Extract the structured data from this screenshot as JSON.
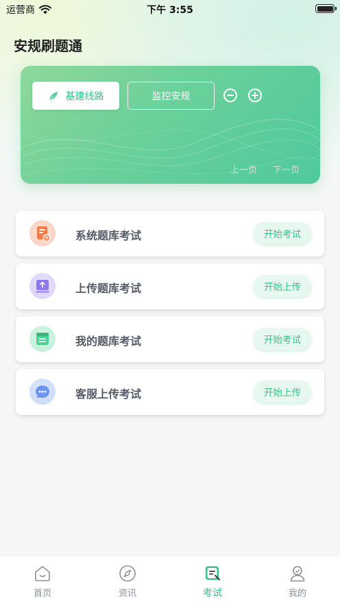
{
  "status_bar": {
    "carrier": "运营商",
    "time": "下午 3:55"
  },
  "page_title": "安规刷题通",
  "hero": {
    "routes": [
      {
        "label": "基建线路",
        "selected": true
      },
      {
        "label": "监控安规",
        "selected": false
      }
    ],
    "prev_page": "上一页",
    "next_page": "下一页"
  },
  "cards": [
    {
      "title": "系统题库考试",
      "button": "开始考试",
      "icon": "document-icon",
      "color": "#f59a72"
    },
    {
      "title": "上传题库考试",
      "button": "开始上传",
      "icon": "upload-tray-icon",
      "color": "#8c7bf0"
    },
    {
      "title": "我的题库考试",
      "button": "开始考试",
      "icon": "list-box-icon",
      "color": "#4fcf94"
    },
    {
      "title": "客服上传考试",
      "button": "开始上传",
      "icon": "chat-bubble-icon",
      "color": "#6b94f5"
    }
  ],
  "tab_bar": {
    "items": [
      {
        "label": "首页",
        "icon": "home-icon",
        "active": false
      },
      {
        "label": "资讯",
        "icon": "compass-icon",
        "active": false
      },
      {
        "label": "考试",
        "icon": "exam-icon",
        "active": true
      },
      {
        "label": "我的",
        "icon": "user-icon",
        "active": false
      }
    ]
  },
  "colors": {
    "accent": "#3fbf89",
    "accent_light": "#e7f8f0"
  }
}
